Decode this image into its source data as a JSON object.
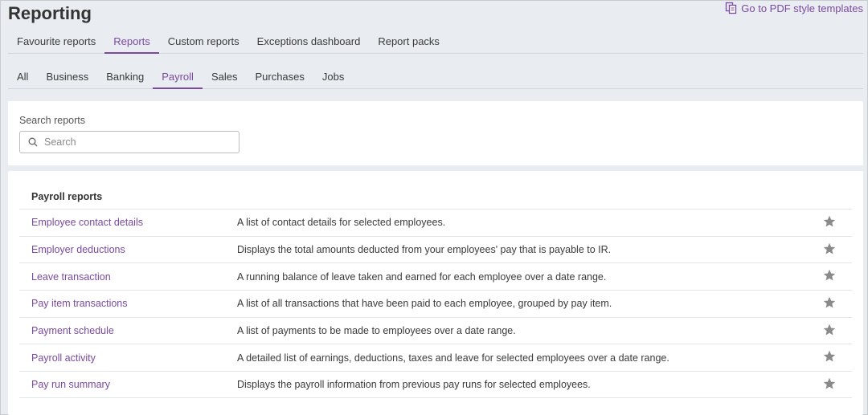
{
  "page": {
    "title": "Reporting"
  },
  "pdf_link": {
    "label": "Go to PDF style templates",
    "icon": "document-copy-icon"
  },
  "primary_tabs": [
    {
      "label": "Favourite reports",
      "active": false
    },
    {
      "label": "Reports",
      "active": true
    },
    {
      "label": "Custom reports",
      "active": false
    },
    {
      "label": "Exceptions dashboard",
      "active": false
    },
    {
      "label": "Report packs",
      "active": false
    }
  ],
  "secondary_tabs": [
    {
      "label": "All",
      "active": false
    },
    {
      "label": "Business",
      "active": false
    },
    {
      "label": "Banking",
      "active": false
    },
    {
      "label": "Payroll",
      "active": true
    },
    {
      "label": "Sales",
      "active": false
    },
    {
      "label": "Purchases",
      "active": false
    },
    {
      "label": "Jobs",
      "active": false
    }
  ],
  "search": {
    "label": "Search reports",
    "placeholder": "Search",
    "value": ""
  },
  "payroll_reports": {
    "title": "Payroll reports",
    "rows": [
      {
        "name": "Employee contact details",
        "description": "A list of contact details for selected employees."
      },
      {
        "name": "Employer deductions",
        "description": "Displays the total amounts deducted from your employees' pay that is payable to IR."
      },
      {
        "name": "Leave transaction",
        "description": "A running balance of leave taken and earned for each employee over a date range."
      },
      {
        "name": "Pay item transactions",
        "description": "A list of all transactions that have been paid to each employee, grouped by pay item."
      },
      {
        "name": "Payment schedule",
        "description": "A list of payments to be made to employees over a date range."
      },
      {
        "name": "Payroll activity",
        "description": "A detailed list of earnings, deductions, taxes and leave for selected employees over a date range."
      },
      {
        "name": "Pay run summary",
        "description": "Displays the payroll information from previous pay runs for selected employees."
      }
    ]
  },
  "colors": {
    "accent": "#7a4a9e",
    "background": "#e9edf1",
    "star": "#8a8a8a"
  }
}
